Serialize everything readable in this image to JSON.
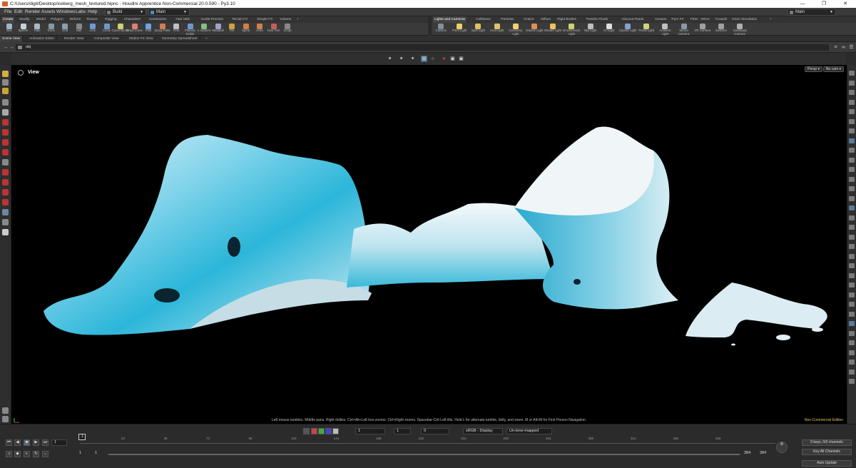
{
  "window": {
    "title": "C:/Users/digit/Desktop/iceberg_mesh_textured.hipnc - Houdini Apprentice Non-Commercial 20.0.590 - Py3.10"
  },
  "menu": {
    "items": [
      "File",
      "Edit",
      "Render",
      "Assets",
      "Windows",
      "Labs",
      "Help"
    ],
    "desktop": "Build",
    "context": "Main",
    "right_context": "Main"
  },
  "shelf_left": {
    "tabs": [
      "Create",
      "Modify",
      "Model",
      "Polygon",
      "Deform",
      "Texture",
      "Rigging",
      "Characters",
      "Constraints",
      "Hair Utils",
      "Guide Process",
      "Terrain FX",
      "Simple FX",
      "Volume",
      "+"
    ],
    "tools": [
      "Box",
      "Sphere",
      "Tube",
      "Torus",
      "Grid",
      "Null",
      "Line",
      "Circle",
      "Curve Bezier",
      "Draw Curve",
      "Path",
      "Spray Paint",
      "Font",
      "Platonic Solids",
      "L-System",
      "Metaball",
      "File",
      "Spiral",
      "Helix",
      "Now Tool",
      "Script"
    ]
  },
  "shelf_right": {
    "tabs": [
      "Lights and Cameras",
      "Collisions",
      "Particles",
      "Grains",
      "Vellum",
      "Rigid Bodies",
      "Particle Fluids",
      "Viscous Fluids",
      "Oceans",
      "Pyro FX",
      "FEM",
      "Wires",
      "Crowds",
      "Drive Simulation",
      "+"
    ],
    "tools": [
      "Camera",
      "Point Light",
      "Spot Light",
      "Area Light",
      "Geometry Light",
      "Volume Light",
      "Distant Light",
      "Environment Light",
      "Sky Light",
      "GI Light",
      "Caustic Light",
      "Portal Light",
      "Ambient Light",
      "Stereo Camera",
      "VR Camera",
      "Switcher",
      "Gamepad Camera"
    ]
  },
  "pane_tabs": [
    "Scene View",
    "Animation Editor",
    "Render View",
    "Composite View",
    "Motion FX View",
    "Geometry Spreadsheet",
    "+"
  ],
  "path": {
    "value": "obj"
  },
  "viewport": {
    "label": "View",
    "persp": "Persp",
    "cam": "No cam",
    "hint": "Left mouse tumbles. Middle pans. Right dollies. Ctrl+Alt+Left box-zooms. Ctrl+Right zooms. Spacebar-Ctrl-Left tilts. Hold L for alternate tumble, dolly, and zoom. M or Alt+M for First Person Navigation.",
    "edition": "Non-Commercial Edition"
  },
  "playbar": {
    "frame": "1",
    "start": "1",
    "start2": "1",
    "end": "384",
    "end2": "384",
    "range_start": "1",
    "range_start2": "1",
    "field_a": "1",
    "field_b": "1",
    "field_c": "0",
    "display": "sRGB - Display",
    "tonemap": "Un-tone-mapped",
    "ticks": [
      "24",
      "48",
      "72",
      "96",
      "120",
      "144",
      "168",
      "192",
      "216",
      "240",
      "264",
      "288",
      "312",
      "336",
      "360"
    ],
    "keys": "0 keys, 0/0 channels",
    "key_all": "Key All Channels",
    "auto_update": "Auto Update"
  },
  "colors": {
    "ice_light": "#e9f3f7",
    "ice_blue": "#2bb6d9",
    "accent": "#d4602a"
  }
}
